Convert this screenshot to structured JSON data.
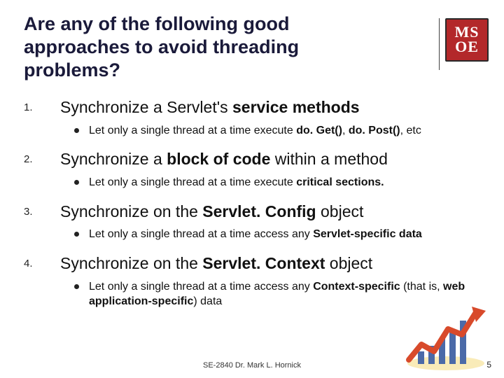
{
  "title": "Are any of the following good approaches to avoid threading problems?",
  "logo": {
    "line1": "MS",
    "line2": "OE"
  },
  "items": [
    {
      "num": "1.",
      "main_parts": [
        "Synchronize a Servlet's ",
        "service methods"
      ],
      "main_bold": [
        false,
        true
      ],
      "sub_parts": [
        "Let only a single thread at a time execute ",
        "do. Get()",
        ", ",
        "do. Post()",
        ", etc"
      ],
      "sub_bold": [
        false,
        true,
        false,
        true,
        false
      ]
    },
    {
      "num": "2.",
      "main_parts": [
        "Synchronize a ",
        "block of code",
        " within a method"
      ],
      "main_bold": [
        false,
        true,
        false
      ],
      "sub_parts": [
        "Let only a single thread at a time execute ",
        "critical sections."
      ],
      "sub_bold": [
        false,
        true
      ]
    },
    {
      "num": "3.",
      "main_parts": [
        "Synchronize on the ",
        "Servlet. Config",
        " object"
      ],
      "main_bold": [
        false,
        true,
        false
      ],
      "sub_parts": [
        "Let only a single thread at a time access any ",
        "Servlet-specific data"
      ],
      "sub_bold": [
        false,
        true
      ]
    },
    {
      "num": "4.",
      "main_parts": [
        "Synchronize on the ",
        "Servlet. Context",
        " object"
      ],
      "main_bold": [
        false,
        true,
        false
      ],
      "sub_parts": [
        "Let only a single thread at a time access any ",
        "Context-specific",
        " (that is, ",
        "web application-specific",
        ") data"
      ],
      "sub_bold": [
        false,
        true,
        false,
        true,
        false
      ]
    }
  ],
  "footer": "SE-2840 Dr. Mark L. Hornick",
  "page": "5"
}
